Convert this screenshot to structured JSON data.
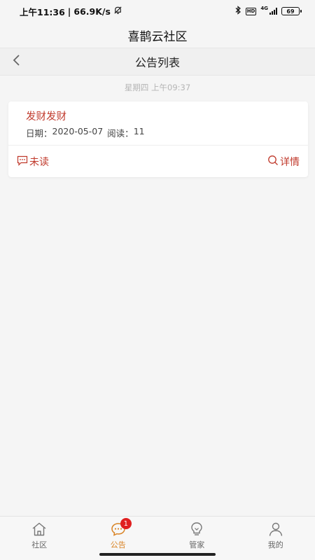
{
  "status_bar": {
    "time": "上午11:36",
    "separator": "|",
    "network_speed": "66.9K/s",
    "network_type": "4G",
    "hd_label": "HD",
    "battery": "69",
    "icons": [
      "mute-bell-icon",
      "bluetooth-icon",
      "hd-icon",
      "signal-icon",
      "battery-icon"
    ]
  },
  "app": {
    "title": "喜鹊云社区"
  },
  "nav": {
    "title": "公告列表",
    "back_icon": "chevron-left-icon"
  },
  "timestamp": "星期四 上午09:37",
  "notice": {
    "title": "发财发财",
    "date_label": "日期：",
    "date": "2020-05-07",
    "reads_label": "阅读：",
    "reads": "11",
    "unread_label": "未读",
    "detail_label": "详情"
  },
  "tabs": [
    {
      "label": "社区",
      "icon": "home-icon",
      "active": false
    },
    {
      "label": "公告",
      "icon": "chat-bubble-icon",
      "active": true,
      "badge": "1"
    },
    {
      "label": "管家",
      "icon": "lightbulb-icon",
      "active": false
    },
    {
      "label": "我的",
      "icon": "user-icon",
      "active": false
    }
  ],
  "colors": {
    "accent": "#d98324",
    "notice_red": "#c0392b",
    "badge": "#e02020"
  }
}
